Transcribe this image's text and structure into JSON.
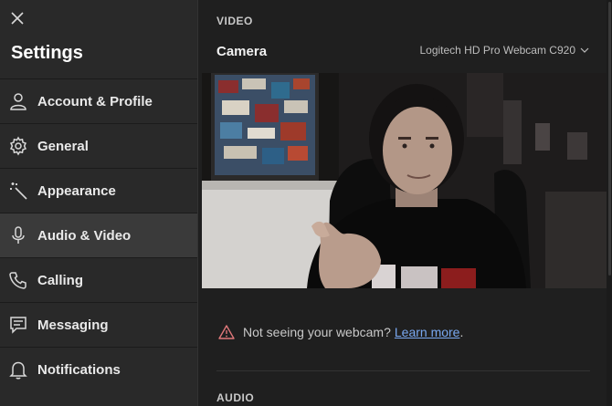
{
  "sidebar": {
    "close_icon": "close-icon",
    "title": "Settings",
    "items": [
      {
        "label": "Account & Profile",
        "icon": "person-icon",
        "active": false
      },
      {
        "label": "General",
        "icon": "gear-icon",
        "active": false
      },
      {
        "label": "Appearance",
        "icon": "magic-wand-icon",
        "active": false
      },
      {
        "label": "Audio & Video",
        "icon": "microphone-icon",
        "active": true
      },
      {
        "label": "Calling",
        "icon": "phone-icon",
        "active": false
      },
      {
        "label": "Messaging",
        "icon": "message-icon",
        "active": false
      },
      {
        "label": "Notifications",
        "icon": "bell-icon",
        "active": false
      }
    ]
  },
  "main": {
    "video_section_title": "VIDEO",
    "camera_label": "Camera",
    "camera_selected": "Logitech HD Pro Webcam C920",
    "warning_text": "Not seeing your webcam?",
    "learn_more_link": "Learn more",
    "warning_period": ".",
    "audio_section_title": "AUDIO"
  },
  "colors": {
    "sidebar_bg": "#292929",
    "main_bg": "#1f1f1f",
    "active_item_bg": "#3a3a3a",
    "link": "#79a8f0",
    "warning_icon": "#e0787a"
  }
}
